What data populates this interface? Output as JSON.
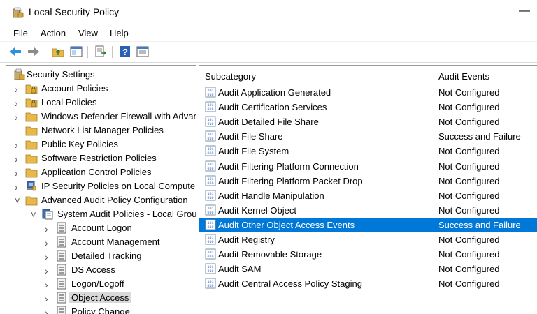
{
  "window": {
    "title": "Local Security Policy"
  },
  "menu": [
    "File",
    "Action",
    "View",
    "Help"
  ],
  "toolbar": {
    "icons": [
      "back-icon",
      "forward-icon",
      "up-folder-icon",
      "show-hide-tree-icon",
      "export-list-icon",
      "help-icon",
      "properties-icon"
    ]
  },
  "tree": [
    {
      "label": "Security Settings",
      "level": 0,
      "expander": "",
      "icon": "security-settings-icon"
    },
    {
      "label": "Account Policies",
      "level": 1,
      "expander": ">",
      "icon": "folder-lock-icon"
    },
    {
      "label": "Local Policies",
      "level": 1,
      "expander": ">",
      "icon": "folder-lock-icon"
    },
    {
      "label": "Windows Defender Firewall with Advanced Security",
      "level": 1,
      "expander": ">",
      "icon": "folder-icon"
    },
    {
      "label": "Network List Manager Policies",
      "level": 1,
      "expander": "",
      "icon": "folder-icon"
    },
    {
      "label": "Public Key Policies",
      "level": 1,
      "expander": ">",
      "icon": "folder-icon"
    },
    {
      "label": "Software Restriction Policies",
      "level": 1,
      "expander": ">",
      "icon": "folder-icon"
    },
    {
      "label": "Application Control Policies",
      "level": 1,
      "expander": ">",
      "icon": "folder-icon"
    },
    {
      "label": "IP Security Policies on Local Computer",
      "level": 1,
      "expander": ">",
      "icon": "ip-security-icon"
    },
    {
      "label": "Advanced Audit Policy Configuration",
      "level": 1,
      "expander": "v",
      "icon": "folder-icon"
    },
    {
      "label": "System Audit Policies - Local Group Policy Object",
      "level": 2,
      "expander": "v",
      "icon": "audit-policy-icon"
    },
    {
      "label": "Account Logon",
      "level": 3,
      "expander": ">",
      "icon": "policy-doc-icon"
    },
    {
      "label": "Account Management",
      "level": 3,
      "expander": ">",
      "icon": "policy-doc-icon"
    },
    {
      "label": "Detailed Tracking",
      "level": 3,
      "expander": ">",
      "icon": "policy-doc-icon"
    },
    {
      "label": "DS Access",
      "level": 3,
      "expander": ">",
      "icon": "policy-doc-icon"
    },
    {
      "label": "Logon/Logoff",
      "level": 3,
      "expander": ">",
      "icon": "policy-doc-icon"
    },
    {
      "label": "Object Access",
      "level": 3,
      "expander": ">",
      "icon": "policy-doc-icon",
      "selected": true
    },
    {
      "label": "Policy Change",
      "level": 3,
      "expander": ">",
      "icon": "policy-doc-icon"
    }
  ],
  "list": {
    "columns": [
      "Subcategory",
      "Audit Events"
    ],
    "rows": [
      {
        "name": "Audit Application Generated",
        "value": "Not Configured"
      },
      {
        "name": "Audit Certification Services",
        "value": "Not Configured"
      },
      {
        "name": "Audit Detailed File Share",
        "value": "Not Configured"
      },
      {
        "name": "Audit File Share",
        "value": "Success and Failure"
      },
      {
        "name": "Audit File System",
        "value": "Not Configured"
      },
      {
        "name": "Audit Filtering Platform Connection",
        "value": "Not Configured"
      },
      {
        "name": "Audit Filtering Platform Packet Drop",
        "value": "Not Configured"
      },
      {
        "name": "Audit Handle Manipulation",
        "value": "Not Configured"
      },
      {
        "name": "Audit Kernel Object",
        "value": "Not Configured"
      },
      {
        "name": "Audit Other Object Access Events",
        "value": "Success and Failure",
        "selected": true
      },
      {
        "name": "Audit Registry",
        "value": "Not Configured"
      },
      {
        "name": "Audit Removable Storage",
        "value": "Not Configured"
      },
      {
        "name": "Audit SAM",
        "value": "Not Configured"
      },
      {
        "name": "Audit Central Access Policy Staging",
        "value": "Not Configured"
      }
    ]
  },
  "colors": {
    "selection": "#0078d7",
    "tree_selection": "#d9d9d9",
    "folder": "#e8b94a"
  }
}
